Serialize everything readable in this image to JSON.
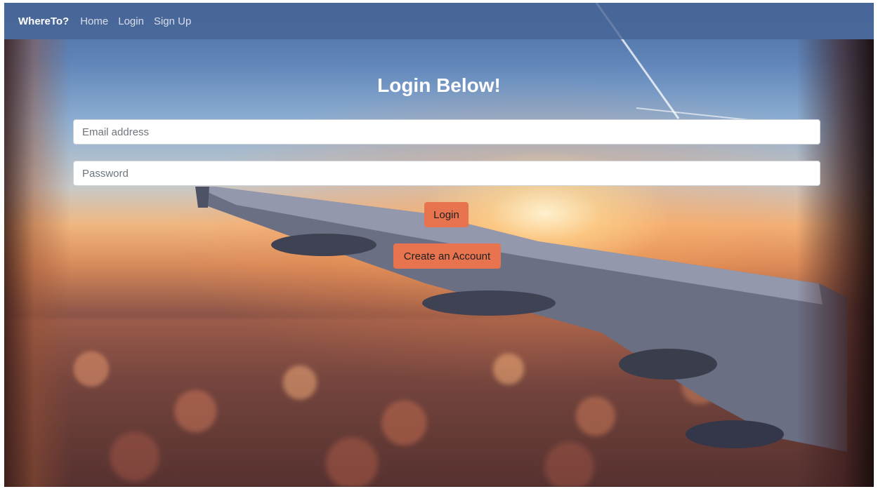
{
  "navbar": {
    "brand": "WhereTo?",
    "links": [
      "Home",
      "Login",
      "Sign Up"
    ]
  },
  "main": {
    "title": "Login Below!",
    "email": {
      "placeholder": "Email address",
      "value": ""
    },
    "password": {
      "placeholder": "Password",
      "value": ""
    },
    "login_label": "Login",
    "create_account_label": "Create an Account"
  },
  "colors": {
    "button": "#e8734f",
    "navbar": "#46649a"
  }
}
